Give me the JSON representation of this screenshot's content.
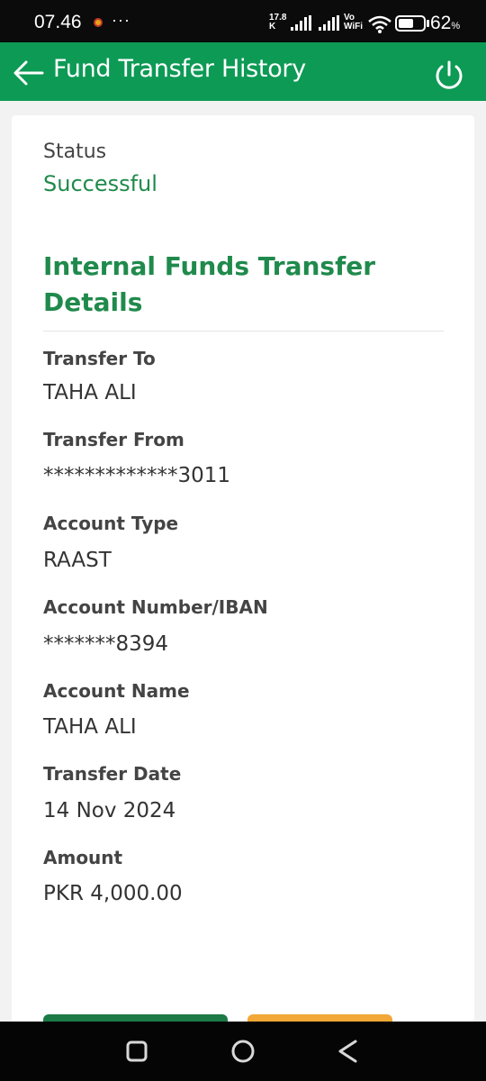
{
  "status_bar": {
    "time": "07.46",
    "more": "···",
    "speed_value": "17.8",
    "speed_unit": "K",
    "volte_top": "Vo",
    "volte_bottom": "WiFi",
    "battery_level": 0.62,
    "battery_number": "62",
    "battery_unit": "%"
  },
  "header": {
    "title": "Fund Transfer History",
    "back_icon": "arrow-left-icon",
    "power_icon": "power-icon",
    "color": "#0d9a55"
  },
  "status": {
    "label": "Status",
    "value": "Successful"
  },
  "details": {
    "title_line1": "Internal Funds Transfer",
    "title_line2": "Details",
    "fields": [
      {
        "label": "Transfer To",
        "value": "TAHA ALI"
      },
      {
        "label": "Transfer From",
        "value": "*************3011"
      },
      {
        "label": "Account Type",
        "value": "RAAST"
      },
      {
        "label": "Account Number/IBAN",
        "value": "*******8394"
      },
      {
        "label": "Account Name",
        "value": "TAHA ALI"
      },
      {
        "label": "Transfer Date",
        "value": "14 Nov 2024"
      },
      {
        "label": "Amount",
        "value": "PKR 4,000.00"
      }
    ]
  },
  "colors": {
    "accent_green": "#1f8a4c",
    "button_green": "#1c7a46",
    "button_orange": "#f1a836"
  },
  "nav": {
    "recents_icon": "square-icon",
    "home_icon": "circle-icon",
    "back_icon": "triangle-back-icon"
  }
}
